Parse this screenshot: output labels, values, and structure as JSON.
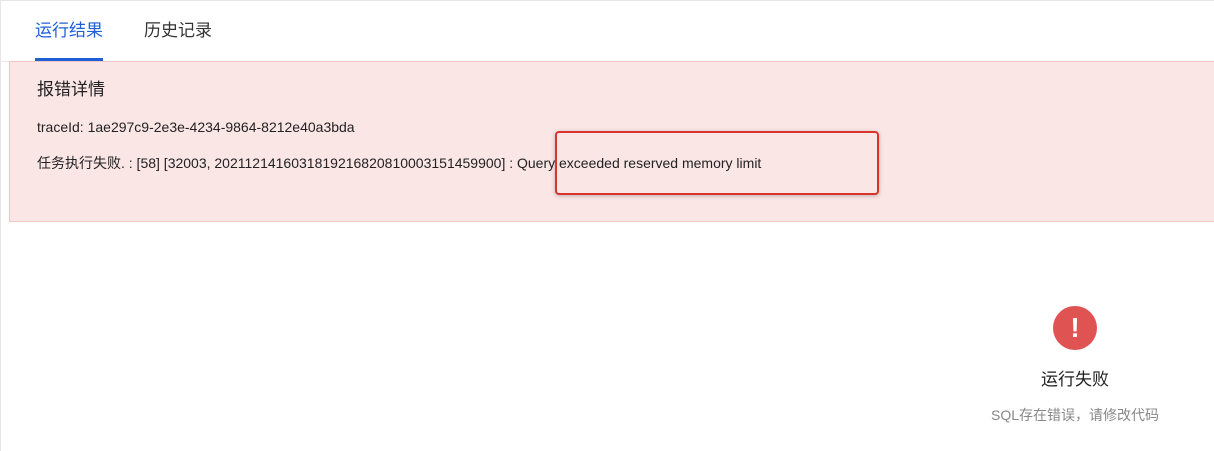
{
  "tabs": [
    {
      "label": "运行结果",
      "active": true
    },
    {
      "label": "历史记录",
      "active": false
    }
  ],
  "error": {
    "title": "报错详情",
    "trace_line": "traceId: 1ae297c9-2e3e-4234-9864-8212e40a3bda",
    "message_line": "任务执行失败. : [58] [32003, 2021121416031819216820810003151459900] : Query exceeded reserved memory limit"
  },
  "status": {
    "icon": "exclamation-circle-icon",
    "icon_glyph": "!",
    "title": "运行失败",
    "subtitle": "SQL存在错误，请修改代码"
  },
  "colors": {
    "accent": "#1f5fd6",
    "error_bg": "#fbe6e6",
    "highlight_border": "#d9332e",
    "status_icon": "#e05353"
  }
}
